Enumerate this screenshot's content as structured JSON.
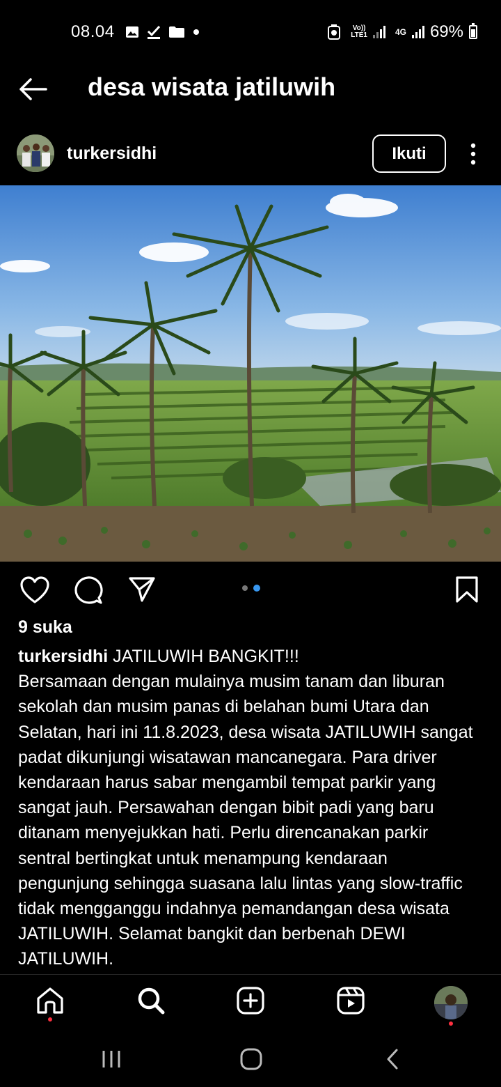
{
  "status_bar": {
    "time": "08.04",
    "notification_icons": [
      "gallery-icon",
      "check-icon",
      "folder-icon",
      "dot-icon"
    ],
    "volte_top": "Vo))",
    "volte_bottom": "LTE1",
    "network_label": "4G",
    "battery_percent": "69%"
  },
  "header": {
    "title": "desa wisata jatiluwih"
  },
  "post": {
    "username": "turkersidhi",
    "follow_label": "Ikuti",
    "carousel": {
      "count": 2,
      "active_index": 1
    },
    "likes": "9 suka",
    "caption_user": "turkersidhi",
    "caption_lines": [
      "JATILUWIH BANGKIT!!!",
      "Bersamaan dengan mulainya musim tanam dan liburan",
      "sekolah dan musim panas di belahan bumi Utara dan",
      "Selatan, hari ini 11.8.2023, desa wisata JATILUWIH sangat",
      "padat dikunjungi wisatawan mancanegara. Para driver",
      "kendaraan harus sabar mengambil tempat parkir yang",
      "sangat jauh. Persawahan dengan bibit padi yang baru",
      "ditanam menyejukkan hati. Perlu direncanakan parkir",
      "sentral bertingkat untuk menampung kendaraan",
      "pengunjung sehingga suasana lalu lintas yang slow-traffic",
      "tidak mengganggu indahnya pemandangan desa wisata",
      "JATILUWIH. Selamat bangkit dan berbenah DEWI",
      "JATILUWIH."
    ]
  },
  "bottom_nav": {
    "items": [
      "home-icon",
      "search-icon",
      "create-icon",
      "reels-icon",
      "profile-avatar"
    ]
  },
  "system_nav": {
    "items": [
      "recent-apps-icon",
      "home-button-icon",
      "back-icon"
    ]
  },
  "colors": {
    "accent_blue": "#3897f0",
    "notification_red": "#ff3040",
    "background": "#000000"
  }
}
